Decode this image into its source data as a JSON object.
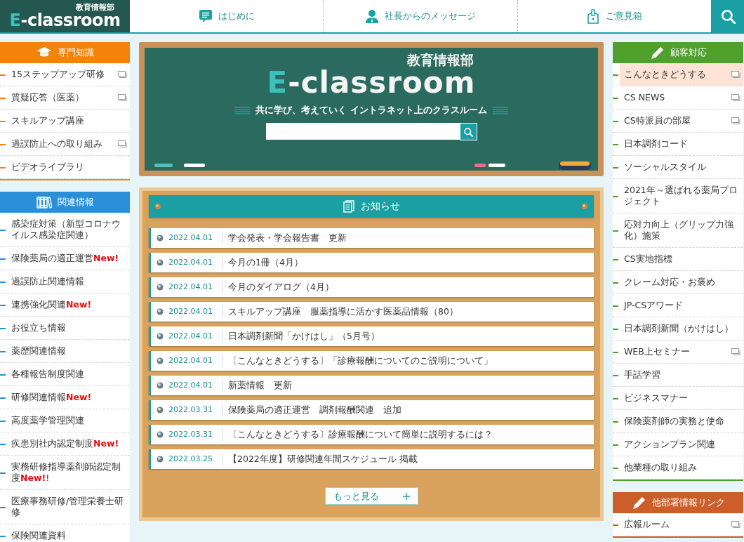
{
  "header": {
    "logo": {
      "department": "教育情報部",
      "title": "E-classroom"
    },
    "nav": [
      {
        "label": "はじめに",
        "kind": "speech"
      },
      {
        "label": "社長からのメッセージ",
        "kind": "person"
      },
      {
        "label": "ご意見箱",
        "kind": "box"
      }
    ]
  },
  "left_sidebar": [
    {
      "title": "専門知識",
      "kind": "cap",
      "color": "#f5820b",
      "items": [
        {
          "label": "15ステップアップ研修",
          "doc": true,
          "selected": false
        },
        {
          "label": "質疑応答（医薬）",
          "doc": true,
          "selected": false
        },
        {
          "label": "スキルアップ講座",
          "doc": false,
          "selected": false
        },
        {
          "label": "過誤防止への取り組み",
          "doc": true,
          "selected": false
        },
        {
          "label": "ビデオライブラリ",
          "doc": false,
          "selected": false
        }
      ]
    },
    {
      "title": "関連情報",
      "kind": "books",
      "color": "#2a8fd8",
      "items": [
        {
          "label": "感染症対策（新型コロナウイルス感染症関連）",
          "doc": false,
          "selected": false
        },
        {
          "label": "保険薬局の適正運営**New!**",
          "doc": false,
          "selected": false
        },
        {
          "label": "過誤防止関連情報",
          "doc": false,
          "selected": false
        },
        {
          "label": "連携強化関連**New!**",
          "doc": false,
          "selected": false
        },
        {
          "label": "お役立ち情報",
          "doc": false,
          "selected": false
        },
        {
          "label": "薬歴関連情報",
          "doc": false,
          "selected": false
        },
        {
          "label": "各種報告制度関連",
          "doc": false,
          "selected": false
        },
        {
          "label": "研修関連情報**New!**",
          "doc": false,
          "selected": false
        },
        {
          "label": "高度薬学管理関連",
          "doc": false,
          "selected": false
        },
        {
          "label": "疾患別社内認定制度**New!**",
          "doc": false,
          "selected": false
        },
        {
          "label": "実務研修指導薬剤師認定制度**New!**!",
          "doc": false,
          "selected": false
        },
        {
          "label": "医療事務研修/管理栄養士研修",
          "doc": false,
          "selected": false
        },
        {
          "label": "保険関連資料",
          "doc": false,
          "selected": false
        }
      ]
    }
  ],
  "banner": {
    "department": "教育情報部",
    "title": "E-classroom",
    "tagline": "共に学び、考えていく イントラネット上のクラスルーム"
  },
  "notices": {
    "title": "お知らせ",
    "items": [
      {
        "date": "2022.04.01",
        "text": "学会発表・学会報告書　更新"
      },
      {
        "date": "2022.04.01",
        "text": "今月の1冊（4月）"
      },
      {
        "date": "2022.04.01",
        "text": "今月のダイアログ（4月）"
      },
      {
        "date": "2022.04.01",
        "text": "スキルアップ講座　服薬指導に活かす医薬品情報（80）"
      },
      {
        "date": "2022.04.01",
        "text": "日本調剤新聞「かけはし」（5月号）"
      },
      {
        "date": "2022.04.01",
        "text": "〔こんなときどうする〕「診療報酬についてのご説明について」"
      },
      {
        "date": "2022.04.01",
        "text": "新薬情報　更新"
      },
      {
        "date": "2022.03.31",
        "text": "保険薬局の適正運営　調剤報酬関連　追加"
      },
      {
        "date": "2022.03.31",
        "text": "〔こんなときどうする〕診療報酬について簡単に説明するには？"
      },
      {
        "date": "2022.03.25",
        "text": "【2022年度】研修関連年間スケジュール 掲載"
      }
    ],
    "more": "もっと見る"
  },
  "right_sidebar": [
    {
      "title": "顧客対応",
      "kind": "pen",
      "color": "#4ea12c",
      "items": [
        {
          "label": "こんなときどうする",
          "doc": true,
          "selected": true
        },
        {
          "label": "CS NEWS",
          "doc": true,
          "selected": false
        },
        {
          "label": "CS特派員の部屋",
          "doc": true,
          "selected": false
        },
        {
          "label": "日本調剤コード",
          "doc": false,
          "selected": false
        },
        {
          "label": "ソーシャルスタイル",
          "doc": false,
          "selected": false
        },
        {
          "label": "2021年～選ばれる薬局プロジェクト",
          "doc": false,
          "selected": false
        },
        {
          "label": "応対力向上（グリップ力強化）施策",
          "doc": false,
          "selected": false
        },
        {
          "label": "CS実地指標",
          "doc": false,
          "selected": false
        },
        {
          "label": "クレーム対応・お褒め",
          "doc": false,
          "selected": false
        },
        {
          "label": "JP-CSアワード",
          "doc": false,
          "selected": false
        },
        {
          "label": "日本調剤新聞（かけはし）",
          "doc": false,
          "selected": false
        },
        {
          "label": "WEB上セミナー",
          "doc": true,
          "selected": false
        },
        {
          "label": "手話学習",
          "doc": false,
          "selected": false
        },
        {
          "label": "ビジネスマナー",
          "doc": false,
          "selected": false
        },
        {
          "label": "保険薬剤師の実務と使命",
          "doc": false,
          "selected": false
        },
        {
          "label": "アクションプラン関連",
          "doc": false,
          "selected": false
        },
        {
          "label": "他業種の取り組み",
          "doc": false,
          "selected": false
        }
      ]
    },
    {
      "title": "他部署情報リンク",
      "kind": "pen",
      "color": "#cc5e2a",
      "items": [
        {
          "label": "広報ルーム",
          "doc": true,
          "selected": false
        }
      ]
    }
  ]
}
